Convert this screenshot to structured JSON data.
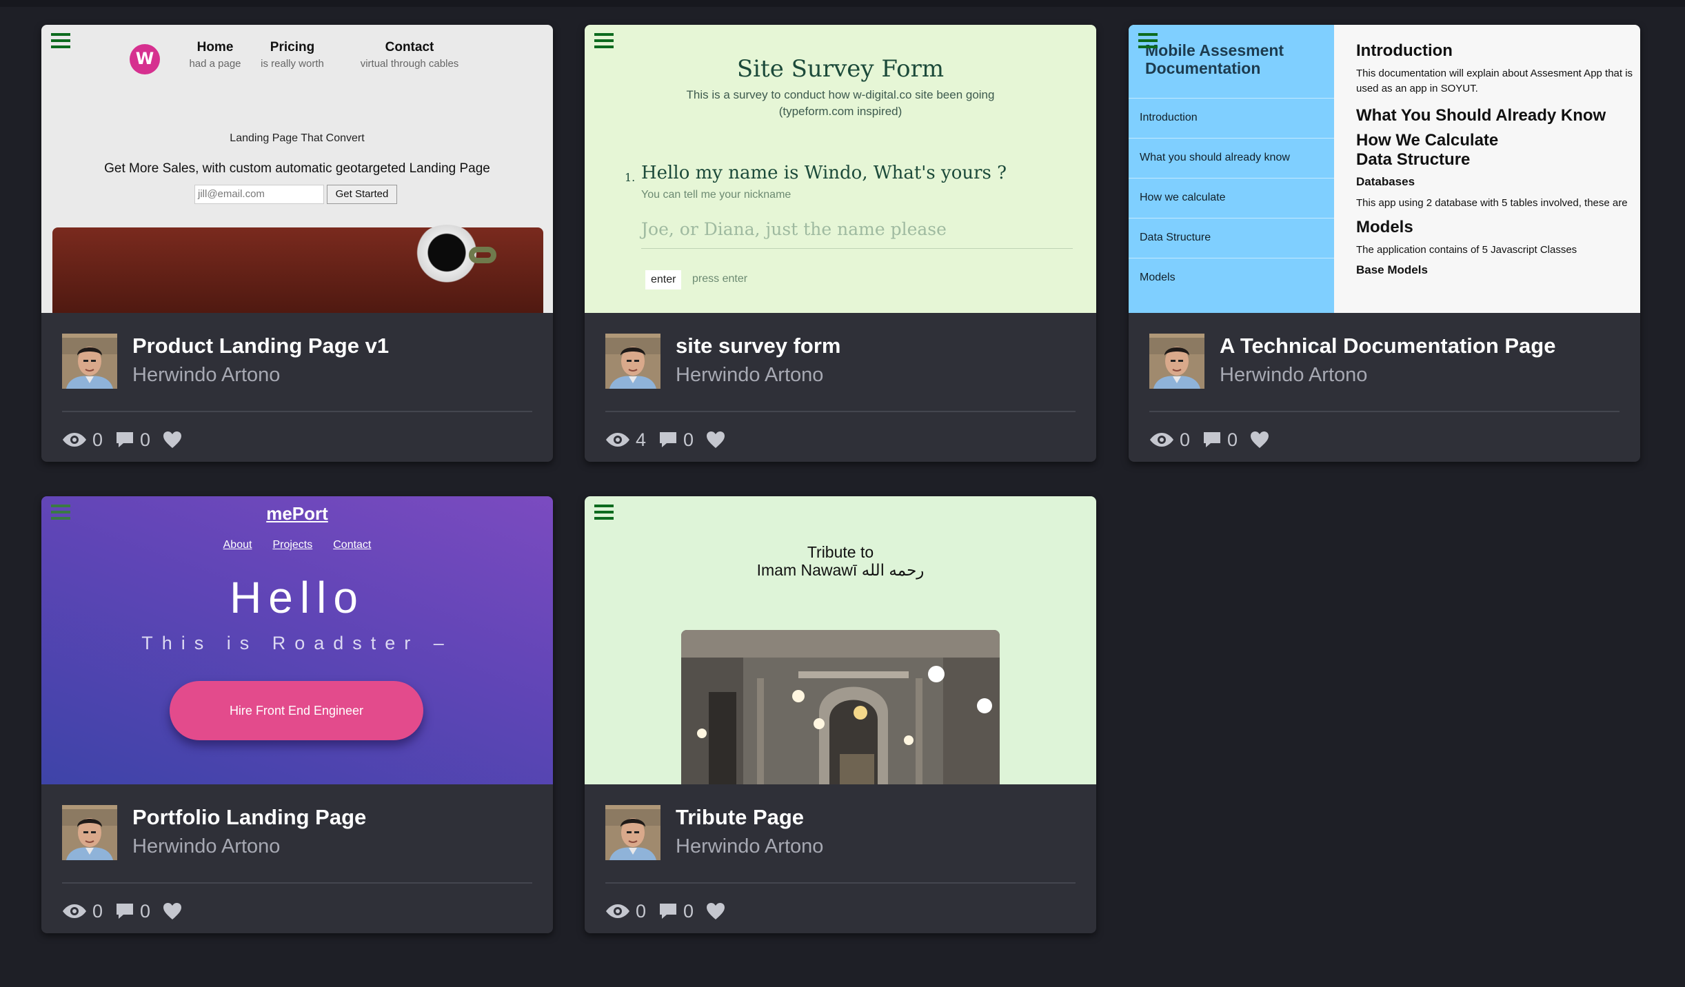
{
  "cards": [
    {
      "title": "Product Landing Page v1",
      "author": "Herwindo Artono",
      "views": "0",
      "comments": "0",
      "preview": {
        "logo_letter": "W",
        "nav": [
          {
            "label": "Home",
            "sub": "had a page"
          },
          {
            "label": "Pricing",
            "sub": "is really worth"
          },
          {
            "label": "Contact",
            "sub": "virtual through cables"
          }
        ],
        "tagline": "Landing Page That Convert",
        "headline": "Get More Sales, with custom automatic geotargeted Landing Page",
        "email_placeholder": "jill@email.com",
        "cta": "Get Started"
      }
    },
    {
      "title": "site survey form",
      "author": "Herwindo Artono",
      "views": "4",
      "comments": "0",
      "preview": {
        "heading": "Site Survey Form",
        "description": "This is a survey to conduct how w-digital.co site been going (typeform.com inspired)",
        "question_number": "1.",
        "question": "Hello my name is Windo, What's yours ?",
        "hint": "You can tell me your nickname",
        "answer_placeholder": "Joe, or Diana, just the name please",
        "enter_label": "enter",
        "press_label": "press enter"
      }
    },
    {
      "title": "A Technical Documentation Page",
      "author": "Herwindo Artono",
      "views": "0",
      "comments": "0",
      "preview": {
        "sidebar_title": "Mobile Assesment Documentation",
        "sidebar_items": [
          "Introduction",
          "What you should already know",
          "How we calculate",
          "Data Structure",
          "Models"
        ],
        "intro_heading": "Introduction",
        "intro_text": "This documentation will explain about Assesment App that is used as an app in SOYUT.",
        "intro_text_2": "app in SOYUT.",
        "h_know": "What You Should Already Know",
        "h_calc": "How We Calculate",
        "h_struct": "Data Structure",
        "h_db": "Databases",
        "db_text": "This app using 2 database with 5 tables involved, these are",
        "h_models": "Models",
        "models_text": "The application contains of 5 Javascript Classes",
        "h_base": "Base Models"
      }
    },
    {
      "title": "Portfolio Landing Page",
      "author": "Herwindo Artono",
      "views": "0",
      "comments": "0",
      "preview": {
        "brand": "mePort",
        "links": [
          "About",
          "Projects",
          "Contact"
        ],
        "hello": "Hello",
        "subtitle": "This is Roadster –",
        "cta": "Hire Front End Engineer"
      }
    },
    {
      "title": "Tribute Page",
      "author": "Herwindo Artono",
      "views": "0",
      "comments": "0",
      "preview": {
        "line1": "Tribute to",
        "line2": "Imam Nawawī رحمه الله"
      }
    }
  ],
  "icons": {
    "views": "eye-icon",
    "comments": "comment-icon",
    "likes": "heart-icon",
    "menu": "hamburger-menu-icon"
  },
  "colors": {
    "page_bg": "#1e1f26",
    "card_bg": "#2f3038",
    "menu_icon": "#0d6b1f",
    "author_text": "#a7a9b3"
  }
}
